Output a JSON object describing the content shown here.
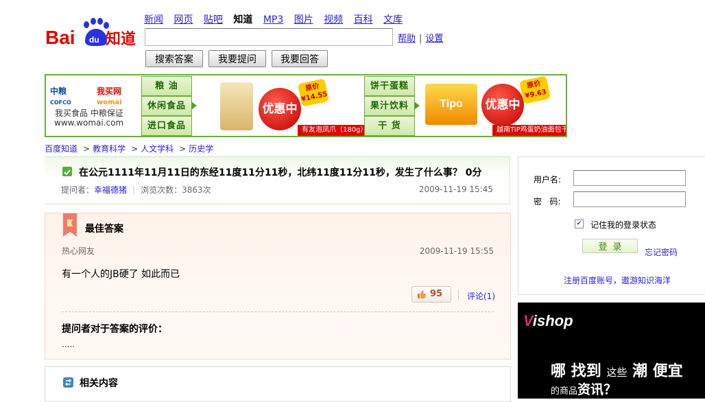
{
  "logo": {
    "text_left": "Bai",
    "text_paw": "du",
    "text_right": "知道"
  },
  "nav": {
    "items": [
      {
        "label": "新闻",
        "current": false
      },
      {
        "label": "网页",
        "current": false
      },
      {
        "label": "贴吧",
        "current": false
      },
      {
        "label": "知道",
        "current": true
      },
      {
        "label": "MP3",
        "current": false
      },
      {
        "label": "图片",
        "current": false
      },
      {
        "label": "视频",
        "current": false
      },
      {
        "label": "百科",
        "current": false
      },
      {
        "label": "文库",
        "current": false
      }
    ],
    "help": "帮助",
    "settings": "设置",
    "separator": "|"
  },
  "search": {
    "value": "",
    "btn_search": "搜索答案",
    "btn_ask": "我要提问",
    "btn_answer": "我要回答"
  },
  "banner": {
    "brand_cofco_cn": "中粮",
    "brand_cofco_en": "COFCO",
    "brand_womai": "我买网",
    "brand_womai_en": "womai",
    "slogan": "我买食品 中粮保证",
    "url": "www.womai.com",
    "categories_left": [
      "粮 油",
      "休闲食品",
      "进口食品"
    ],
    "categories_right": [
      "饼干蛋糕",
      "果汁饮料",
      "干 货"
    ],
    "promo_text": "优惠中",
    "price_tag_label": "原价",
    "price_left": "¥14.55",
    "price_right": "¥9.63",
    "product_left_caption": "有友泡凤爪（180g）",
    "product_right_caption": "越南TiP鸡蛋奶油面包干",
    "product_right_brand": "Tipo"
  },
  "breadcrumb": [
    "百度知道",
    "教育科学",
    "人文学科",
    "历史学"
  ],
  "question": {
    "title": "在公元1111年11月11日的东经11度11分11秒，北纬11度11分11秒，发生了什么事？ 0分",
    "asker_label": "提问者：",
    "asker": "幸福德猪",
    "views_label": "浏览次数：",
    "views": "3863次",
    "date": "2009-11-19 15:45"
  },
  "best_answer": {
    "heading": "最佳答案",
    "user": "热心网友",
    "date": "2009-11-19 15:55",
    "body": "有一个人的JB硬了  如此而已",
    "likes": "95",
    "comments": "评论(1)",
    "eval_heading": "提问者对于答案的评价：",
    "eval_body": "....."
  },
  "related": {
    "heading": "相关内容"
  },
  "login": {
    "username_label": "用户名:",
    "password_label": "密   码:",
    "remember_label": "记住我的登录状态",
    "remember_checked": true,
    "login_button": "登录",
    "forgot": "忘记密码",
    "register": "注册百度账号，遨游知识海洋"
  },
  "ad": {
    "logo_v": "V",
    "logo_text": "ishop",
    "line1_a": "哪",
    "line1_b": "找到",
    "line1_c": "这些",
    "line1_d": "潮",
    "line1_e": "便宜",
    "line2_a": "的商品",
    "line2_b": "资讯？"
  },
  "colors": {
    "link": "#261cdc",
    "baidu_red": "#e10601",
    "banner_green": "#6aaf3c"
  }
}
